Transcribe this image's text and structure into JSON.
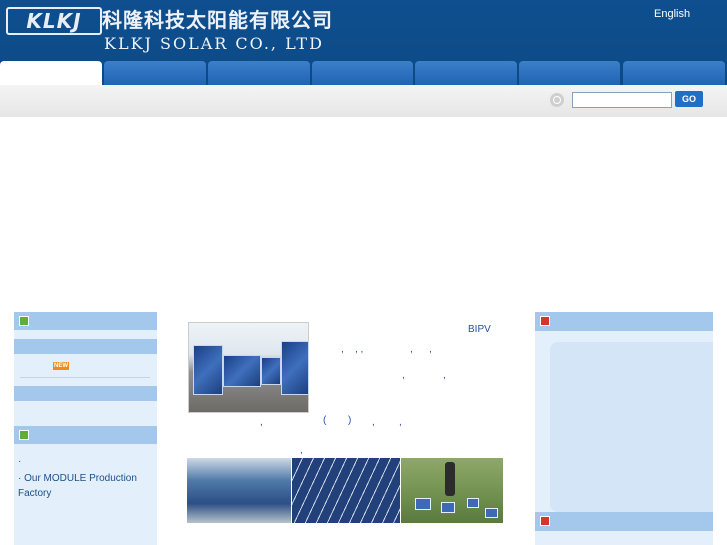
{
  "header": {
    "logo_mark": "KLKJ",
    "company_name_cn": "科隆科技太阳能有限公司",
    "company_name_en": "KLKJ SOLAR CO., LTD",
    "language_link": "English"
  },
  "nav": {
    "tab_count": 7,
    "active_index": 0
  },
  "search": {
    "value": "",
    "placeholder": "",
    "go_label": "GO"
  },
  "left": {
    "badge_label": "NEW",
    "list_bullet": "·",
    "factory_link": "· Our MODULE Production Factory"
  },
  "center": {
    "bipv_label": "BIPV",
    "punctuation": [
      ",",
      ", ,",
      ",",
      ",",
      ",",
      ",",
      "(",
      ")",
      ",",
      ",",
      ","
    ]
  },
  "colors": {
    "header_blue": "#0c4a86",
    "nav_tab_blue": "#2a6fbd",
    "sidebar_bar": "#a4c8eb",
    "sidebar_bg": "#e3effa",
    "accent_green": "#5fae3a",
    "accent_red": "#d8352a",
    "go_button": "#1f6fc6"
  },
  "icons": {
    "search": "magnifier-icon",
    "section_left": "green-square-icon",
    "section_right": "red-square-icon"
  }
}
